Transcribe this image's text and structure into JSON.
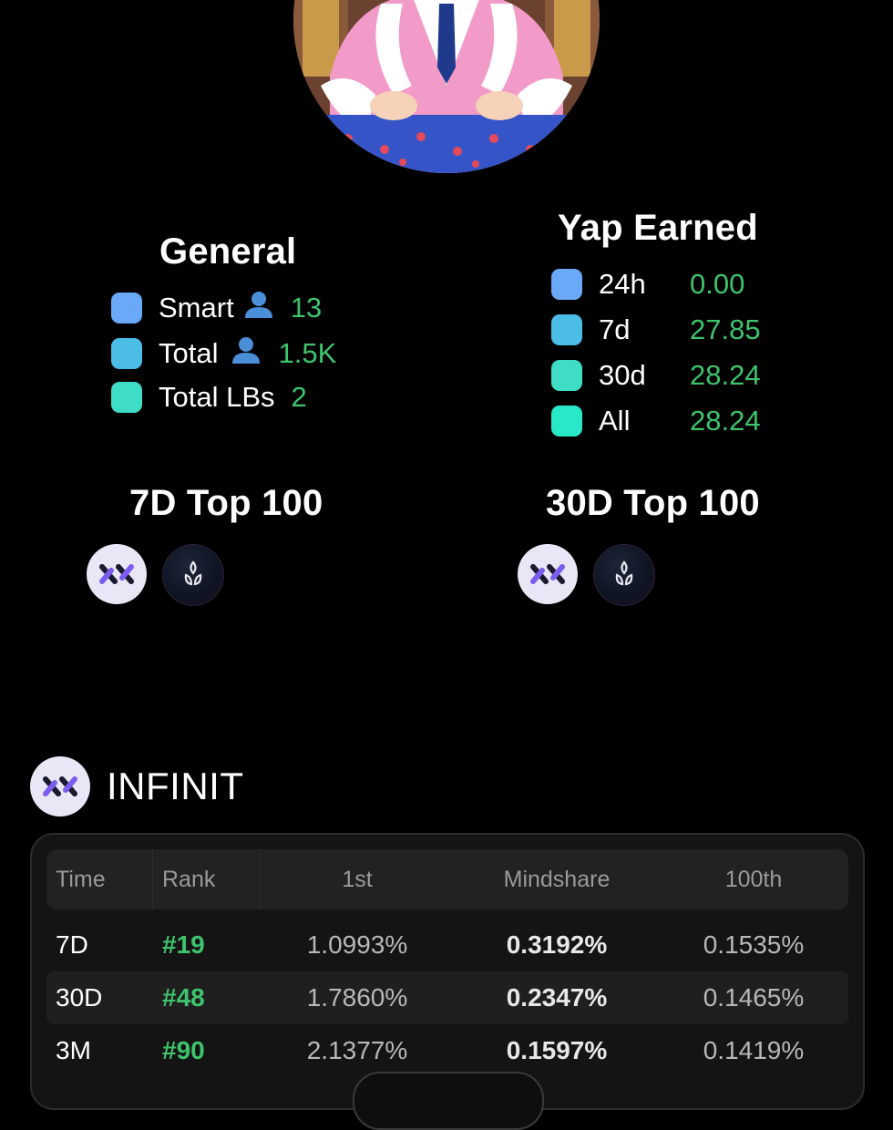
{
  "general": {
    "title": "General",
    "items": [
      {
        "label": "Smart",
        "icon": "person-icon",
        "value": "13",
        "color": "#6aa8f8"
      },
      {
        "label": "Total",
        "icon": "person-icon",
        "value": "1.5K",
        "color": "#4bbde6"
      },
      {
        "label": "Total LBs",
        "value": "2",
        "color": "#3fdcc6"
      }
    ]
  },
  "yap": {
    "title": "Yap Earned",
    "items": [
      {
        "label": "24h",
        "value": "0.00",
        "color": "#6aa8f8"
      },
      {
        "label": "7d",
        "value": "27.85",
        "color": "#4bbde6"
      },
      {
        "label": "30d",
        "value": "28.24",
        "color": "#3fdcc6"
      },
      {
        "label": "All",
        "value": "28.24",
        "color": "#28e8c8"
      }
    ]
  },
  "top7d": {
    "title": "7D Top 100",
    "icons": [
      "infinit-logo-icon",
      "seed-logo-icon"
    ]
  },
  "top30d": {
    "title": "30D Top 100",
    "icons": [
      "infinit-logo-icon",
      "seed-logo-icon"
    ]
  },
  "project": {
    "name": "INFINIT",
    "table": {
      "headers": [
        "Time",
        "Rank",
        "1st",
        "Mindshare",
        "100th"
      ],
      "rows": [
        {
          "time": "7D",
          "rank": "#19",
          "first": "1.0993%",
          "mindshare": "0.3192%",
          "hundredth": "0.1535%"
        },
        {
          "time": "30D",
          "rank": "#48",
          "first": "1.7860%",
          "mindshare": "0.2347%",
          "hundredth": "0.1465%"
        },
        {
          "time": "3M",
          "rank": "#90",
          "first": "2.1377%",
          "mindshare": "0.1597%",
          "hundredth": "0.1419%"
        }
      ]
    }
  },
  "colors": {
    "accent_green": "#3ec46d",
    "background": "#000000",
    "card": "#141414"
  }
}
